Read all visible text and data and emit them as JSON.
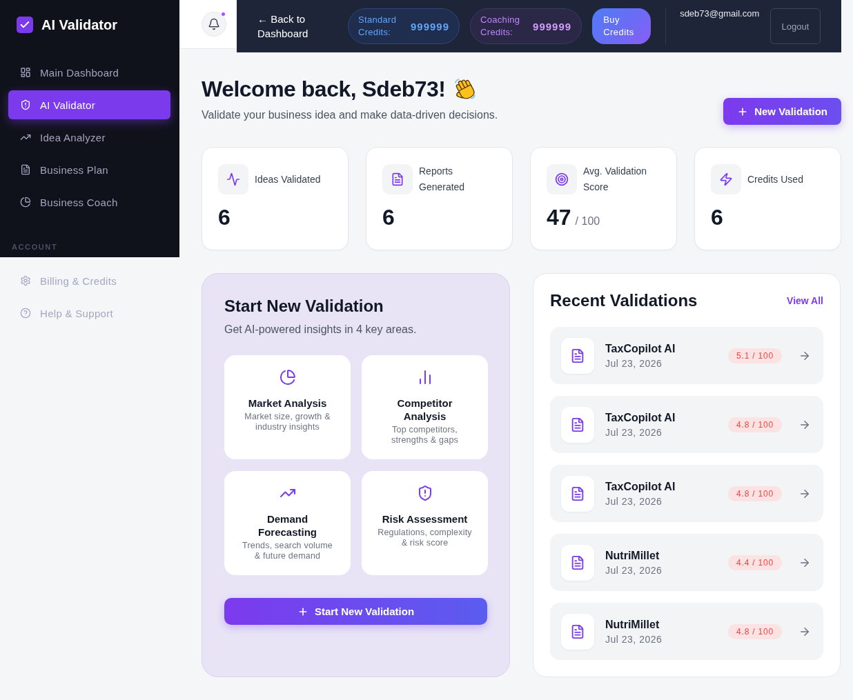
{
  "sidebar": {
    "brand": "AI Validator",
    "nav_items": [
      {
        "kind": "dashboard",
        "label": "Main Dashboard",
        "selected": false
      },
      {
        "kind": "validator",
        "label": "AI Validator",
        "selected": true
      },
      {
        "kind": "analyzer",
        "label": "Idea Analyzer",
        "selected": false
      },
      {
        "kind": "plan",
        "label": "Business Plan",
        "selected": false
      },
      {
        "kind": "coach",
        "label": "Business Coach",
        "selected": false
      }
    ],
    "section_label": "ACCOUNT",
    "account_items": [
      {
        "kind": "billing",
        "label": "Billing & Credits",
        "selected": false
      },
      {
        "kind": "help",
        "label": "Help & Support",
        "selected": false
      }
    ]
  },
  "header": {
    "notification_unread": true,
    "back_link": "← Back to Dashboard",
    "credits": [
      {
        "kind": "standard",
        "label": "Standard Credits:",
        "value": "999999"
      },
      {
        "kind": "coaching",
        "label": "Coaching Credits:",
        "value": "999999"
      }
    ],
    "buy_button": "Buy Credits",
    "email": "sdeb73@gmail.com",
    "logout_button": "Logout"
  },
  "welcome": {
    "title": "Welcome back, Sdeb73!",
    "subtitle": "Validate your business idea and make data-driven decisions.",
    "new_button": "New Validation"
  },
  "stats": [
    {
      "kind": "activity",
      "label": "Ideas Validated",
      "value": "6"
    },
    {
      "kind": "report",
      "label": "Reports Generated",
      "value": "6"
    },
    {
      "kind": "target",
      "label": "Avg. Validation Score",
      "value": "47",
      "suffix": "/ 100"
    },
    {
      "kind": "zap",
      "label": "Credits Used",
      "value": "6"
    }
  ],
  "start_validation": {
    "title": "Start New Validation",
    "subtitle": "Get AI-powered insights in 4 key areas.",
    "areas": [
      {
        "kind": "market",
        "title": "Market Analysis",
        "description": "Market size, growth & industry insights"
      },
      {
        "kind": "competitor",
        "title": "Competitor Analysis",
        "description": "Top competitors, strengths & gaps"
      },
      {
        "kind": "demand",
        "title": "Demand Forecasting",
        "description": "Trends, search volume & future demand"
      },
      {
        "kind": "risk",
        "title": "Risk Assessment",
        "description": "Regulations, complexity & risk score"
      }
    ],
    "button": "Start New Validation"
  },
  "recent_validations": {
    "title": "Recent Validations",
    "view_all": "View All",
    "items": [
      {
        "name": "TaxCopilot AI",
        "date": "Jul 23, 2026",
        "score": "5.1 / 100"
      },
      {
        "name": "TaxCopilot AI",
        "date": "Jul 23, 2026",
        "score": "4.8 / 100"
      },
      {
        "name": "TaxCopilot AI",
        "date": "Jul 23, 2026",
        "score": "4.8 / 100"
      },
      {
        "name": "NutriMillet",
        "date": "Jul 23, 2026",
        "score": "4.4 / 100"
      },
      {
        "name": "NutriMillet",
        "date": "Jul 23, 2026",
        "score": "4.8 / 100"
      }
    ]
  }
}
